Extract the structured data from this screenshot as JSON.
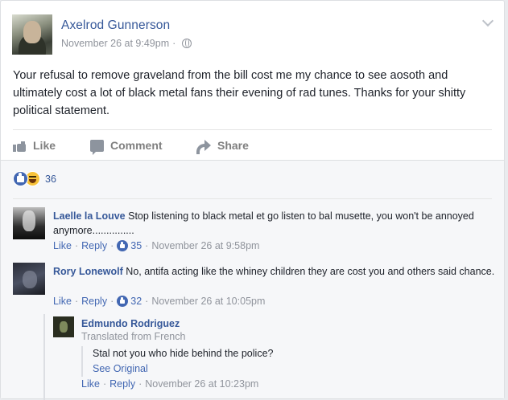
{
  "post": {
    "author": "Axelrod Gunnerson",
    "timestamp": "November 26 at 9:49pm",
    "separator": "·",
    "text": "Your refusal to remove graveland from the bill cost me my chance to see aosoth and ultimately cost a lot of black metal fans their evening of rad tunes. Thanks for your shitty political statement."
  },
  "actions": {
    "like": "Like",
    "comment": "Comment",
    "share": "Share"
  },
  "reactions": {
    "count": "36",
    "types": [
      "like",
      "haha"
    ]
  },
  "comments": [
    {
      "author": "Laelle la Louve",
      "text": "Stop listening to black metal et go listen to bal musette, you won't be annoyed anymore...............",
      "like": "Like",
      "reply": "Reply",
      "likes": "35",
      "timestamp": "November 26 at 9:58pm"
    },
    {
      "author": "Rory Lonewolf",
      "text": "No, antifa acting like the whiney children they are cost you and others said chance.",
      "like": "Like",
      "reply": "Reply",
      "likes": "32",
      "timestamp": "November 26 at 10:05pm"
    }
  ],
  "reply": {
    "author": "Edmundo Rodriguez",
    "translated_label": "Translated from French",
    "text": "Stal not you who hide behind the police?",
    "see_original": "See Original",
    "like": "Like",
    "reply": "Reply",
    "timestamp": "November 26 at 10:23pm"
  },
  "colors": {
    "link": "#365899",
    "meta": "#90949c",
    "like_blue": "#4267b2",
    "haha_yellow": "#f7c239"
  },
  "icons": [
    "globe-icon",
    "chevron-down-icon",
    "like-icon",
    "comment-icon",
    "share-icon",
    "haha-icon"
  ]
}
